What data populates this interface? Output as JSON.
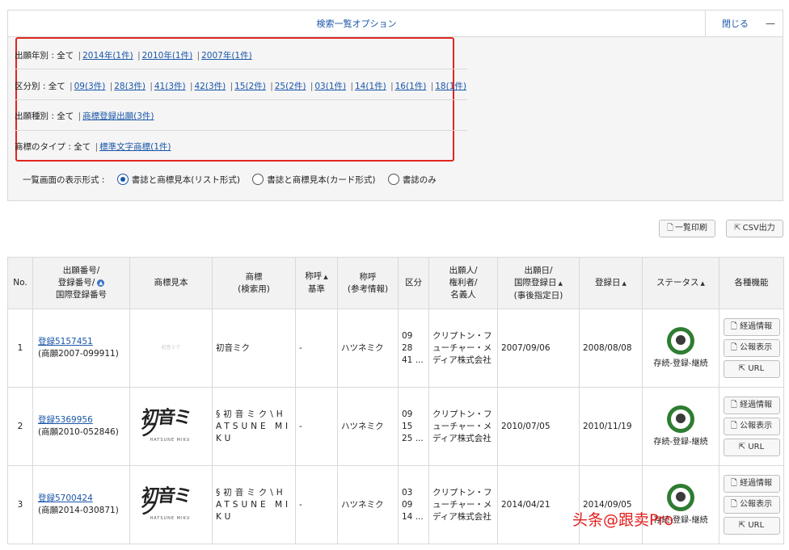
{
  "options": {
    "title": "検索一覧オプション",
    "close_label": "閉じる",
    "close_dash": "—",
    "filters": {
      "year": {
        "label": "出願年別 : 全て",
        "links": [
          "2014年(1件)",
          "2010年(1件)",
          "2007年(1件)"
        ]
      },
      "class": {
        "label": "区分別 : 全て",
        "links": [
          "09(3件)",
          "28(3件)",
          "41(3件)",
          "42(3件)",
          "15(2件)",
          "25(2件)",
          "03(1件)",
          "14(1件)",
          "16(1件)",
          "18(1件)"
        ]
      },
      "type": {
        "label": "出願種別 : 全て",
        "links": [
          "商標登録出願(3件)"
        ]
      },
      "mark_type": {
        "label": "商標のタイプ : 全て",
        "links": [
          "標準文字商標(1件)"
        ]
      }
    },
    "display": {
      "label": "一覧画面の表示形式 :",
      "options": [
        "書誌と商標見本(リスト形式)",
        "書誌と商標見本(カード形式)",
        "書誌のみ"
      ],
      "selected": "書誌と商標見本(リスト形式)"
    }
  },
  "toolbar": {
    "print_label": "一覧印刷",
    "csv_label": "CSV出力"
  },
  "table": {
    "headers": {
      "no": "No.",
      "number_1": "出願番号/",
      "number_2": "登録番号/",
      "number_3": "国際登録番号",
      "image": "商標見本",
      "mark_1": "商標",
      "mark_2": "(検索用)",
      "yomi_1": "称呼",
      "yomi_2": "基準",
      "yomi_ref_1": "称呼",
      "yomi_ref_2": "(参考情報)",
      "class": "区分",
      "owner_1": "出願人/",
      "owner_2": "権利者/",
      "owner_3": "名義人",
      "appdate_1": "出願日/",
      "appdate_2": "国際登録日",
      "appdate_3": "(事後指定日)",
      "regdate": "登録日",
      "status": "ステータス",
      "functions": "各種機能"
    },
    "rows": [
      {
        "no": "1",
        "reg": "登録5157451",
        "app": "(商願2007-099911)",
        "image_text": "初音ミク",
        "mark": "初音ミク",
        "yomi": "-",
        "yomi_ref": "ハツネミク",
        "classes": [
          "09",
          "28",
          "41 ..."
        ],
        "owner": "クリプトン・フューチャー・メディア株式会社",
        "appdate": "2007/09/06",
        "regdate": "2008/08/08",
        "status": "存続-登録-継続"
      },
      {
        "no": "2",
        "reg": "登録5369956",
        "app": "(商願2010-052846)",
        "image_text": "初音ミク",
        "image_sub": "HATSUNE MIKU",
        "mark": "§初音ミク\\HATSUNE MIKU",
        "yomi": "-",
        "yomi_ref": "ハツネミク",
        "classes": [
          "09",
          "15",
          "25 ..."
        ],
        "owner": "クリプトン・フューチャー・メディア株式会社",
        "appdate": "2010/07/05",
        "regdate": "2010/11/19",
        "status": "存続-登録-継続"
      },
      {
        "no": "3",
        "reg": "登録5700424",
        "app": "(商願2014-030871)",
        "image_text": "初音ミク",
        "image_sub": "HATSUNE MIKU",
        "mark": "§初音ミク\\HATSUNE MIKU",
        "yomi": "-",
        "yomi_ref": "ハツネミク",
        "classes": [
          "03",
          "09",
          "14 ..."
        ],
        "owner": "クリプトン・フューチャー・メディア株式会社",
        "appdate": "2014/04/21",
        "regdate": "2014/09/05",
        "status": "存続-登録-継続"
      }
    ],
    "function_buttons": [
      "経過情報",
      "公報表示",
      "URL"
    ]
  },
  "watermark": "头条@跟卖Pro",
  "colors": {
    "link": "#1a56a8",
    "highlight_border": "#e0261f",
    "status_seal": "#2e7d32",
    "watermark": "#e21b1b"
  }
}
